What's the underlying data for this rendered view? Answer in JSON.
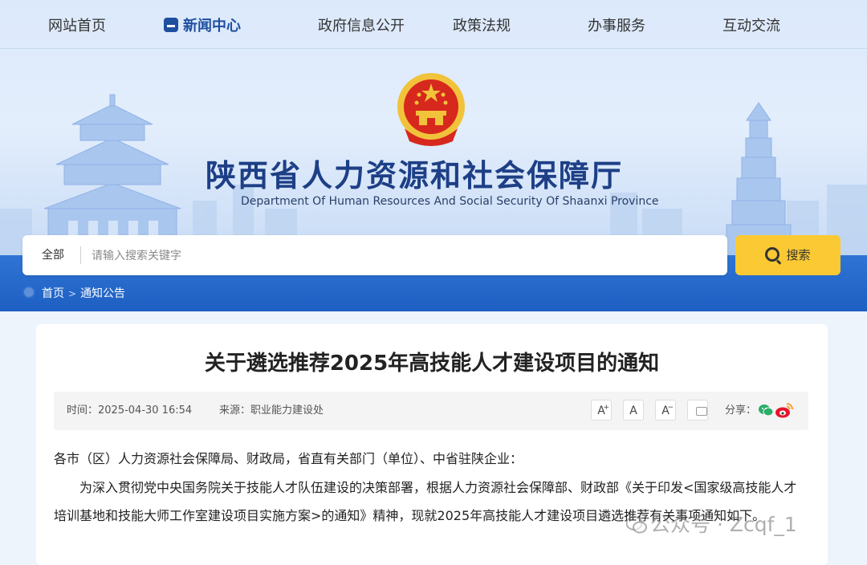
{
  "nav": {
    "items": [
      {
        "label": "网站首页",
        "active": false
      },
      {
        "label": "新闻中心",
        "active": true
      },
      {
        "label": "政府信息公开",
        "active": false
      },
      {
        "label": "政策法规",
        "active": false
      },
      {
        "label": "办事服务",
        "active": false
      },
      {
        "label": "互动交流",
        "active": false
      }
    ]
  },
  "header": {
    "title": "陕西省人力资源和社会保障厅",
    "subtitle": "Department Of Human Resources And Social Security Of Shaanxi Province"
  },
  "search": {
    "scope": "全部",
    "placeholder": "请输入搜索关键字",
    "value": "",
    "button_label": "搜索"
  },
  "breadcrumb": {
    "home": "首页",
    "separator": ">",
    "current": "通知公告"
  },
  "article": {
    "title": "关于遴选推荐2025年高技能人才建设项目的通知",
    "time": "时间：2025-04-30 16:54",
    "source": "来源：职业能力建设处",
    "font_larger": "A",
    "font_larger_mark": "+",
    "font_normal": "A",
    "font_smaller": "A",
    "font_smaller_mark": "−",
    "share_label": "分享：",
    "paragraphs": [
      "各市（区）人力资源社会保障局、财政局，省直有关部门（单位）、中省驻陕企业：",
      "为深入贯彻党中央国务院关于技能人才队伍建设的决策部署，根据人力资源社会保障部、财政部《关于印发<国家级高技能人才培训基地和技能大师工作室建设项目实施方案>的通知》精神，现就2025年高技能人才建设项目遴选推荐有关事项通知如下。"
    ]
  },
  "watermark": {
    "text": "公众号 · Zcqf_1"
  },
  "colors": {
    "band": "#1d5fc2",
    "title_blue": "#1d3f86",
    "search_button": "#fbc933",
    "emblem_red": "#d7281e",
    "emblem_gold": "#f1c33a"
  }
}
